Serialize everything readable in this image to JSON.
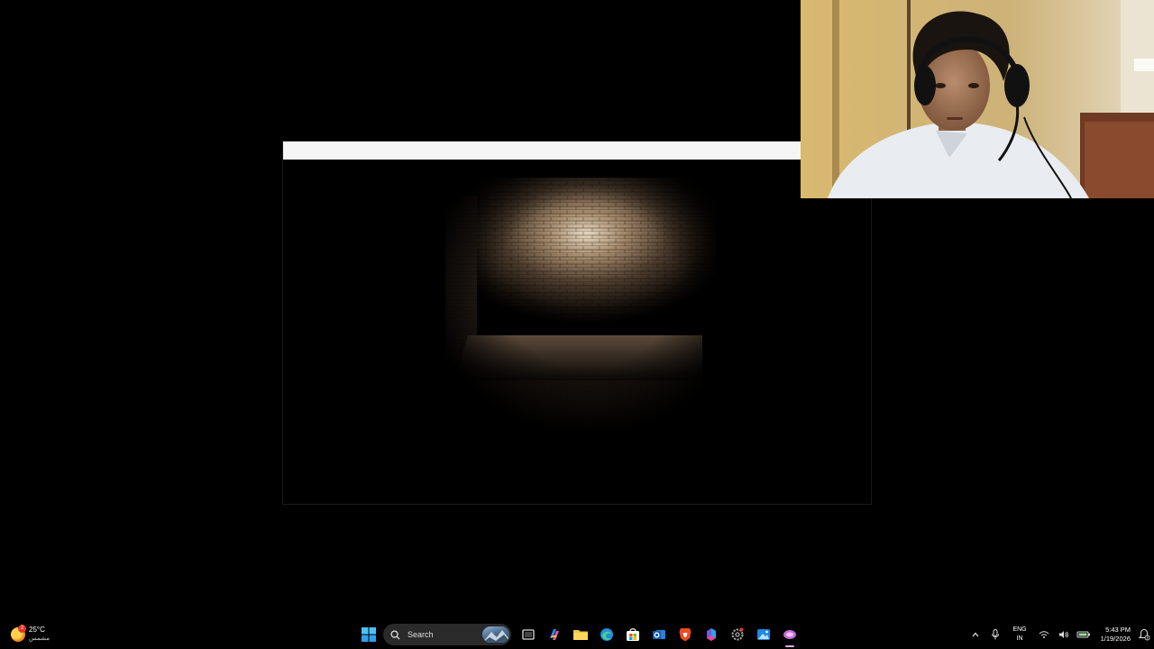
{
  "taskbar": {
    "weather": {
      "temperature": "25°C",
      "condition": "مشمس",
      "badge": "2"
    },
    "search": {
      "label": "Search"
    },
    "apps": [
      {
        "name": "start-icon"
      },
      {
        "name": "task-view-icon"
      },
      {
        "name": "copilot-icon"
      },
      {
        "name": "file-explorer-icon"
      },
      {
        "name": "edge-icon"
      },
      {
        "name": "microsoft-store-icon"
      },
      {
        "name": "outlook-icon"
      },
      {
        "name": "brave-icon"
      },
      {
        "name": "microsoft-365-icon"
      },
      {
        "name": "settings-icon"
      },
      {
        "name": "photos-icon"
      },
      {
        "name": "game-app-icon"
      }
    ],
    "tray": {
      "language_line1": "ENG",
      "language_line2": "IN",
      "time": "5:43 PM",
      "date": "1/19/2026"
    }
  },
  "colors": {
    "taskbar_bg": "#000000",
    "search_bg": "#2a2a2a",
    "window_titlebar": "#f5f5f5",
    "active_indicator": "#e6a6ef"
  }
}
